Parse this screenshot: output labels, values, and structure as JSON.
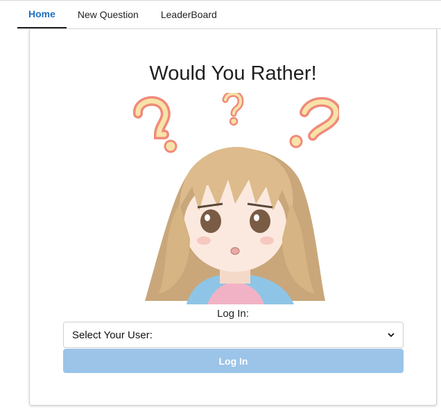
{
  "nav": {
    "tabs": [
      {
        "label": "Home",
        "active": true
      },
      {
        "label": "New Question",
        "active": false
      },
      {
        "label": "LeaderBoard",
        "active": false
      }
    ]
  },
  "card": {
    "title": "Would You Rather!",
    "image": "anime-girl-confused",
    "login_label": "Log In:",
    "select_value": "Select Your User:",
    "login_button": "Log In",
    "colors": {
      "active_tab": "#1e70bf",
      "button_bg": "#9bc4e8",
      "button_text": "#ffffff"
    }
  }
}
